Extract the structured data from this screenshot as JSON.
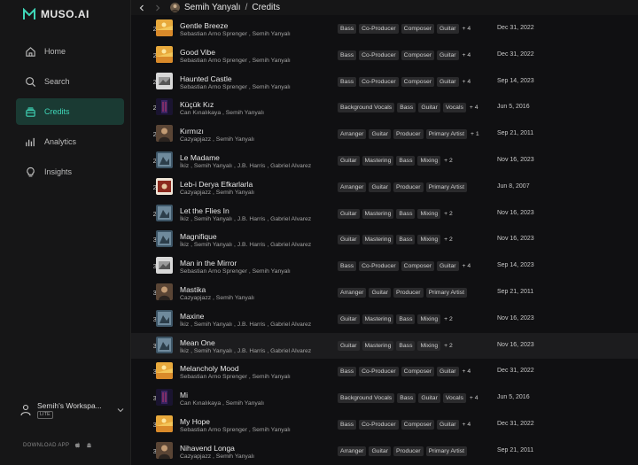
{
  "app": {
    "logo_text": "MUSO.AI",
    "accent": "#3fd6b8"
  },
  "sidebar": {
    "items": [
      {
        "label": "Home",
        "icon": "home-icon",
        "active": false
      },
      {
        "label": "Search",
        "icon": "search-icon",
        "active": false
      },
      {
        "label": "Credits",
        "icon": "credits-icon",
        "active": true
      },
      {
        "label": "Analytics",
        "icon": "analytics-icon",
        "active": false
      },
      {
        "label": "Insights",
        "icon": "lightbulb-icon",
        "active": false
      }
    ],
    "workspace": {
      "name": "Semih's Workspa...",
      "badge": "LITE"
    },
    "download_label": "DOWNLOAD APP"
  },
  "header": {
    "profile_name": "Semih Yanyalı",
    "separator": "/",
    "page": "Credits"
  },
  "rows": [
    {
      "n": "22",
      "title": "Gentle Breeze",
      "artists": "Sebastian Arno Sprenger , Semih Yanyalı",
      "roles": [
        "Bass",
        "Co-Producer",
        "Composer",
        "Guitar"
      ],
      "more": "+ 4",
      "date": "Dec 31, 2022",
      "art": "yellow"
    },
    {
      "n": "23",
      "title": "Good Vibe",
      "artists": "Sebastian Arno Sprenger , Semih Yanyalı",
      "roles": [
        "Bass",
        "Co-Producer",
        "Composer",
        "Guitar"
      ],
      "more": "+ 4",
      "date": "Dec 31, 2022",
      "art": "yellow"
    },
    {
      "n": "24",
      "title": "Haunted Castle",
      "artists": "Sebastian Arno Sprenger , Semih Yanyalı",
      "roles": [
        "Bass",
        "Co-Producer",
        "Composer",
        "Guitar"
      ],
      "more": "+ 4",
      "date": "Sep 14, 2023",
      "art": "gray"
    },
    {
      "n": "25",
      "title": "Küçük Kız",
      "artists": "Can Kınalıkaya , Semih Yanyalı",
      "roles": [
        "Background Vocals",
        "Bass",
        "Guitar",
        "Vocals"
      ],
      "more": "+ 4",
      "date": "Jun 5, 2016",
      "art": "dark"
    },
    {
      "n": "26",
      "title": "Kırmızı",
      "artists": "Cazyapjazz , Semih Yanyalı",
      "roles": [
        "Arranger",
        "Guitar",
        "Producer",
        "Primary Artist"
      ],
      "more": "+ 1",
      "date": "Sep 21, 2011",
      "art": "brown"
    },
    {
      "n": "27",
      "title": "Le Madame",
      "artists": "İkiz , Semih Yanyalı , J.B. Harris , Gabriel Alvarez",
      "roles": [
        "Guitar",
        "Mastering",
        "Bass",
        "Mixing"
      ],
      "more": "+ 2",
      "date": "Nov 16, 2023",
      "art": "blue"
    },
    {
      "n": "28",
      "title": "Leb-i Derya Efkarlarla",
      "artists": "Cazyapjazz , Semih Yanyalı",
      "roles": [
        "Arranger",
        "Guitar",
        "Producer",
        "Primary Artist"
      ],
      "more": "",
      "date": "Jun 8, 2007",
      "art": "red"
    },
    {
      "n": "29",
      "title": "Let the Flies In",
      "artists": "İkiz , Semih Yanyalı , J.B. Harris , Gabriel Alvarez",
      "roles": [
        "Guitar",
        "Mastering",
        "Bass",
        "Mixing"
      ],
      "more": "+ 2",
      "date": "Nov 16, 2023",
      "art": "blue"
    },
    {
      "n": "30",
      "title": "Magnifique",
      "artists": "İkiz , Semih Yanyalı , J.B. Harris , Gabriel Alvarez",
      "roles": [
        "Guitar",
        "Mastering",
        "Bass",
        "Mixing"
      ],
      "more": "+ 2",
      "date": "Nov 16, 2023",
      "art": "blue"
    },
    {
      "n": "31",
      "title": "Man in the Mirror",
      "artists": "Sebastian Arno Sprenger , Semih Yanyalı",
      "roles": [
        "Bass",
        "Co-Producer",
        "Composer",
        "Guitar"
      ],
      "more": "+ 4",
      "date": "Sep 14, 2023",
      "art": "gray"
    },
    {
      "n": "32",
      "title": "Mastika",
      "artists": "Cazyapjazz , Semih Yanyalı",
      "roles": [
        "Arranger",
        "Guitar",
        "Producer",
        "Primary Artist"
      ],
      "more": "",
      "date": "Sep 21, 2011",
      "art": "brown"
    },
    {
      "n": "33",
      "title": "Maxine",
      "artists": "İkiz , Semih Yanyalı , J.B. Harris , Gabriel Alvarez",
      "roles": [
        "Guitar",
        "Mastering",
        "Bass",
        "Mixing"
      ],
      "more": "+ 2",
      "date": "Nov 16, 2023",
      "art": "blue"
    },
    {
      "n": "34",
      "title": "Mean One",
      "artists": "İkiz , Semih Yanyalı , J.B. Harris , Gabriel Alvarez",
      "roles": [
        "Guitar",
        "Mastering",
        "Bass",
        "Mixing"
      ],
      "more": "+ 2",
      "date": "Nov 16, 2023",
      "art": "blue",
      "highlight": true
    },
    {
      "n": "35",
      "title": "Melancholy Mood",
      "artists": "Sebastian Arno Sprenger , Semih Yanyalı",
      "roles": [
        "Bass",
        "Co-Producer",
        "Composer",
        "Guitar"
      ],
      "more": "+ 4",
      "date": "Dec 31, 2022",
      "art": "yellow"
    },
    {
      "n": "36",
      "title": "Mi",
      "artists": "Can Kınalıkaya , Semih Yanyalı",
      "roles": [
        "Background Vocals",
        "Bass",
        "Guitar",
        "Vocals"
      ],
      "more": "+ 4",
      "date": "Jun 5, 2016",
      "art": "dark"
    },
    {
      "n": "37",
      "title": "My Hope",
      "artists": "Sebastian Arno Sprenger , Semih Yanyalı",
      "roles": [
        "Bass",
        "Co-Producer",
        "Composer",
        "Guitar"
      ],
      "more": "+ 4",
      "date": "Dec 31, 2022",
      "art": "yellow"
    },
    {
      "n": "38",
      "title": "Nihavend Longa",
      "artists": "Cazyapjazz , Semih Yanyalı",
      "roles": [
        "Arranger",
        "Guitar",
        "Producer",
        "Primary Artist"
      ],
      "more": "",
      "date": "Sep 21, 2011",
      "art": "brown"
    }
  ]
}
